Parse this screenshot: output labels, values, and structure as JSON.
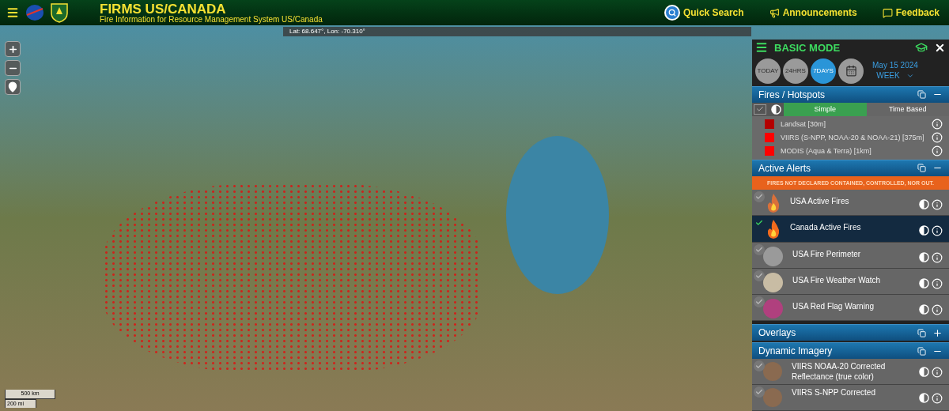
{
  "header": {
    "title": "FIRMS US/CANADA",
    "subtitle": "Fire Information for Resource Management System US/Canada",
    "links": [
      {
        "kind": "search",
        "label": "Quick Search"
      },
      {
        "kind": "announce",
        "label": "Announcements"
      },
      {
        "kind": "feedback",
        "label": "Feedback"
      }
    ]
  },
  "map": {
    "coords": "Lat: 68.647°, Lon: -70.310°",
    "scale": [
      "500 km",
      "200 mi"
    ],
    "controls": [
      {
        "kind": "plus"
      },
      {
        "kind": "minus"
      },
      {
        "kind": "pin"
      }
    ]
  },
  "panel": {
    "mode": "BASIC MODE",
    "time_buttons": [
      {
        "kind": "text",
        "label": "TODAY",
        "selected": false
      },
      {
        "kind": "text",
        "label": "24HRS",
        "selected": false
      },
      {
        "kind": "text",
        "label": "7DAYS",
        "selected": true
      },
      {
        "kind": "calendar",
        "selected": false
      }
    ],
    "date": "May 15 2024",
    "period": "WEEK",
    "fires": {
      "title": "Fires / Hotspots",
      "modes": [
        {
          "label": "Simple",
          "selected": true
        },
        {
          "label": "Time Based",
          "selected": false
        }
      ],
      "layers": [
        {
          "label": "Landsat [30m]",
          "color": "#b30000"
        },
        {
          "label": "VIIRS (S-NPP, NOAA-20 & NOAA-21) [375m]",
          "color": "#ff0000"
        },
        {
          "label": "MODIS (Aqua & Terra) [1km]",
          "color": "#ff0000"
        }
      ]
    },
    "alerts": {
      "title": "Active Alerts",
      "banner": "FIRES NOT DECLARED CONTAINED, CONTROLLED, NOR OUT.",
      "items": [
        {
          "label": "USA Active Fires",
          "checked": false,
          "kind": "flame",
          "color": "#d9703a"
        },
        {
          "label": "Canada Active Fires",
          "checked": true,
          "kind": "flame",
          "color": "#f26b1d"
        },
        {
          "label": "USA Fire Perimeter",
          "checked": false,
          "kind": "disc",
          "color": "#9a9a9a"
        },
        {
          "label": "USA Fire Weather Watch",
          "checked": false,
          "kind": "disc",
          "color": "#c8bca4"
        },
        {
          "label": "USA Red Flag Warning",
          "checked": false,
          "kind": "disc",
          "color": "#b0407e"
        }
      ]
    },
    "overlays": {
      "title": "Overlays",
      "expanded": false
    },
    "imagery": {
      "title": "Dynamic Imagery",
      "expanded": true,
      "items": [
        {
          "label": "VIIRS NOAA-20 Corrected Reflectance (true color)",
          "checked": false
        },
        {
          "label": "VIIRS S-NPP Corrected",
          "checked": false
        }
      ]
    }
  }
}
